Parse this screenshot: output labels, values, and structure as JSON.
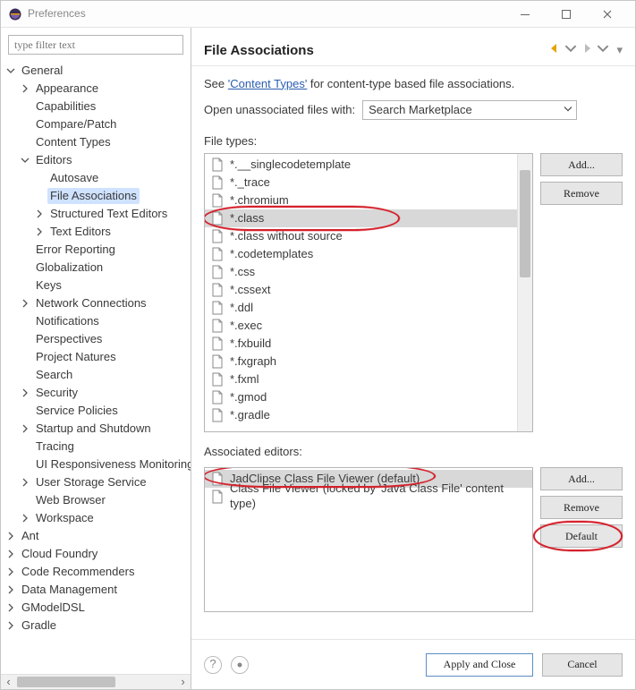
{
  "window": {
    "title": "Preferences"
  },
  "filter_placeholder": "type filter text",
  "tree": {
    "general": "General",
    "appearance": "Appearance",
    "capabilities": "Capabilities",
    "compare": "Compare/Patch",
    "content_types": "Content Types",
    "editors": "Editors",
    "autosave": "Autosave",
    "file_assoc": "File Associations",
    "structured": "Structured Text Editors",
    "text_editors": "Text Editors",
    "error_reporting": "Error Reporting",
    "globalization": "Globalization",
    "keys": "Keys",
    "net": "Network Connections",
    "notifications": "Notifications",
    "perspectives": "Perspectives",
    "project_natures": "Project Natures",
    "search": "Search",
    "security": "Security",
    "service_policies": "Service Policies",
    "startup": "Startup and Shutdown",
    "tracing": "Tracing",
    "ui_resp": "UI Responsiveness Monitoring",
    "user_storage": "User Storage Service",
    "web_browser": "Web Browser",
    "workspace": "Workspace",
    "ant": "Ant",
    "cloud_foundry": "Cloud Foundry",
    "code_rec": "Code Recommenders",
    "data_mgmt": "Data Management",
    "gmodeldsl": "GModelDSL",
    "gradle": "Gradle"
  },
  "page": {
    "title": "File Associations",
    "hint_pre": "See ",
    "hint_link": "'Content Types'",
    "hint_post": " for content-type based file associations.",
    "open_label": "Open unassociated files with:",
    "open_value": "Search Marketplace",
    "filetypes_label": "File types:",
    "assoc_label": "Associated editors:"
  },
  "filetypes": [
    "*.__singlecodetemplate",
    "*._trace",
    "*.chromium",
    "*.class",
    "*.class without source",
    "*.codetemplates",
    "*.css",
    "*.cssext",
    "*.ddl",
    "*.exec",
    "*.fxbuild",
    "*.fxgraph",
    "*.fxml",
    "*.gmod",
    "*.gradle"
  ],
  "filetypes_selected_index": 3,
  "assoc_editors": [
    "JadClipse Class File Viewer (default)",
    "Class File Viewer (locked by 'Java Class File' content type)"
  ],
  "assoc_selected_index": 0,
  "buttons": {
    "add": "Add...",
    "remove": "Remove",
    "default": "Default",
    "apply_close": "Apply and Close",
    "cancel": "Cancel"
  }
}
